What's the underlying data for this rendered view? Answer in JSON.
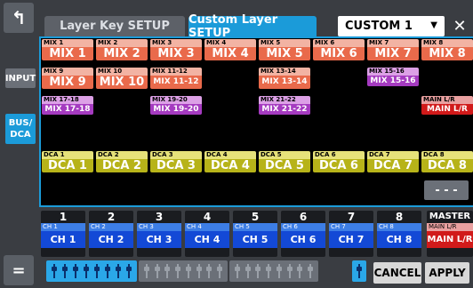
{
  "header": {
    "tab_layer_key": "Layer Key SETUP",
    "tab_custom_layer": "Custom Layer SETUP",
    "layer_select_value": "CUSTOM 1"
  },
  "side_buttons": {
    "input": "INPUT",
    "bus_dca": "BUS/ DCA"
  },
  "grid": {
    "row1": [
      {
        "top": "MIX 1",
        "bottom": "MIX 1"
      },
      {
        "top": "MIX 2",
        "bottom": "MIX 2"
      },
      {
        "top": "MIX 3",
        "bottom": "MIX 3"
      },
      {
        "top": "MIX 4",
        "bottom": "MIX 4"
      },
      {
        "top": "MIX 5",
        "bottom": "MIX 5"
      },
      {
        "top": "MIX 6",
        "bottom": "MIX 6"
      },
      {
        "top": "MIX 7",
        "bottom": "MIX 7"
      },
      {
        "top": "MIX 8",
        "bottom": "MIX 8"
      }
    ],
    "row2": [
      {
        "top": "MIX 9",
        "bottom": "MIX 9"
      },
      {
        "top": "MIX 10",
        "bottom": "MIX 10"
      },
      {
        "top": "MIX 11-12",
        "bottom": "MIX 11-12"
      },
      {
        "top": "MIX 13-14",
        "bottom": "MIX 13-14"
      },
      {
        "top": "MIX 15-16",
        "bottom": "MIX 15-16"
      }
    ],
    "row3": [
      {
        "top": "MIX 17-18",
        "bottom": "MIX 17-18"
      },
      {
        "top": "MIX 19-20",
        "bottom": "MIX 19-20"
      },
      {
        "top": "MIX 21-22",
        "bottom": "MIX 21-22"
      },
      {
        "top": "MAIN L/R",
        "bottom": "MAIN L/R"
      }
    ],
    "row_dca": [
      {
        "top": "DCA 1",
        "bottom": "DCA 1"
      },
      {
        "top": "DCA 2",
        "bottom": "DCA 2"
      },
      {
        "top": "DCA 3",
        "bottom": "DCA 3"
      },
      {
        "top": "DCA 4",
        "bottom": "DCA 4"
      },
      {
        "top": "DCA 5",
        "bottom": "DCA 5"
      },
      {
        "top": "DCA 6",
        "bottom": "DCA 6"
      },
      {
        "top": "DCA 7",
        "bottom": "DCA 7"
      },
      {
        "top": "DCA 8",
        "bottom": "DCA 8"
      }
    ],
    "empty_slot": "- - -"
  },
  "strip": {
    "channels": [
      {
        "num": "1",
        "label": "CH 1",
        "name": "CH 1"
      },
      {
        "num": "2",
        "label": "CH 2",
        "name": "CH 2"
      },
      {
        "num": "3",
        "label": "CH 3",
        "name": "CH 3"
      },
      {
        "num": "4",
        "label": "CH 4",
        "name": "CH 4"
      },
      {
        "num": "5",
        "label": "CH 5",
        "name": "CH 5"
      },
      {
        "num": "6",
        "label": "CH 6",
        "name": "CH 6"
      },
      {
        "num": "7",
        "label": "CH 7",
        "name": "CH 7"
      },
      {
        "num": "8",
        "label": "CH 8",
        "name": "CH 8"
      }
    ],
    "master": {
      "num": "MASTER",
      "label": "MAIN L/R",
      "name": "MAIN L/R"
    }
  },
  "footer": {
    "cancel": "CANCEL",
    "apply": "APPLY",
    "menu_icon": "equals-icon"
  }
}
